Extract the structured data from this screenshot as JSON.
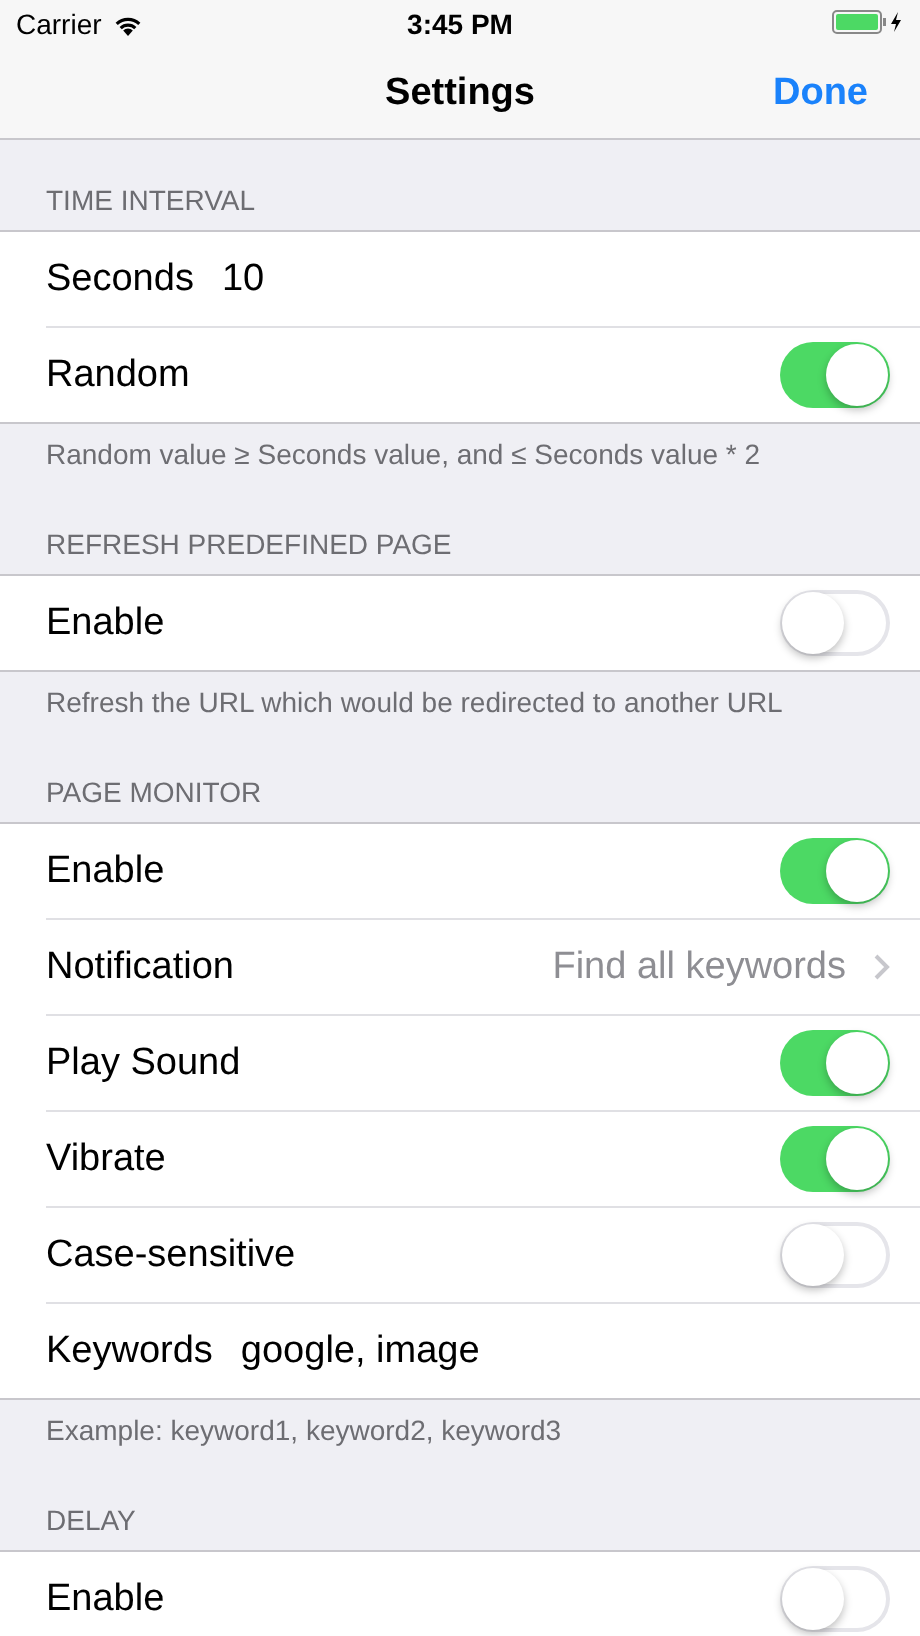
{
  "status_bar": {
    "carrier": "Carrier",
    "time": "3:45 PM"
  },
  "nav": {
    "title": "Settings",
    "done": "Done"
  },
  "sections": [
    {
      "header": "TIME INTERVAL",
      "footer": "Random value ≥ Seconds value, and ≤ Seconds value * 2",
      "rows": [
        {
          "kind": "value",
          "label": "Seconds",
          "value": "10"
        },
        {
          "kind": "toggle",
          "label": "Random",
          "on": true
        }
      ]
    },
    {
      "header": "REFRESH PREDEFINED PAGE",
      "footer": "Refresh the URL which would be redirected to another URL",
      "rows": [
        {
          "kind": "toggle",
          "label": "Enable",
          "on": false
        }
      ]
    },
    {
      "header": "PAGE MONITOR",
      "footer": "Example: keyword1, keyword2, keyword3",
      "rows": [
        {
          "kind": "toggle",
          "label": "Enable",
          "on": true
        },
        {
          "kind": "disclosure",
          "label": "Notification",
          "detail": "Find all keywords"
        },
        {
          "kind": "toggle",
          "label": "Play Sound",
          "on": true
        },
        {
          "kind": "toggle",
          "label": "Vibrate",
          "on": true
        },
        {
          "kind": "toggle",
          "label": "Case-sensitive",
          "on": false
        },
        {
          "kind": "value",
          "label": "Keywords",
          "value": "google, image"
        }
      ]
    },
    {
      "header": "DELAY",
      "rows": [
        {
          "kind": "toggle",
          "label": "Enable",
          "on": false
        }
      ]
    }
  ]
}
